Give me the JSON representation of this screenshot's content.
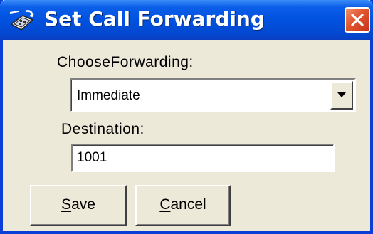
{
  "window": {
    "title": "Set Call Forwarding",
    "title_icon": "phone-forward-icon",
    "close_icon": "close-icon",
    "accent_color": "#0052df",
    "close_color": "#e0552e"
  },
  "form": {
    "forwarding_label": "ChooseForwarding:",
    "forwarding_value": "Immediate",
    "destination_label": "Destination:",
    "destination_value": "1001"
  },
  "buttons": {
    "save_mnemonic": "S",
    "save_rest": "ave",
    "cancel_mnemonic": "C",
    "cancel_rest": "ancel"
  }
}
